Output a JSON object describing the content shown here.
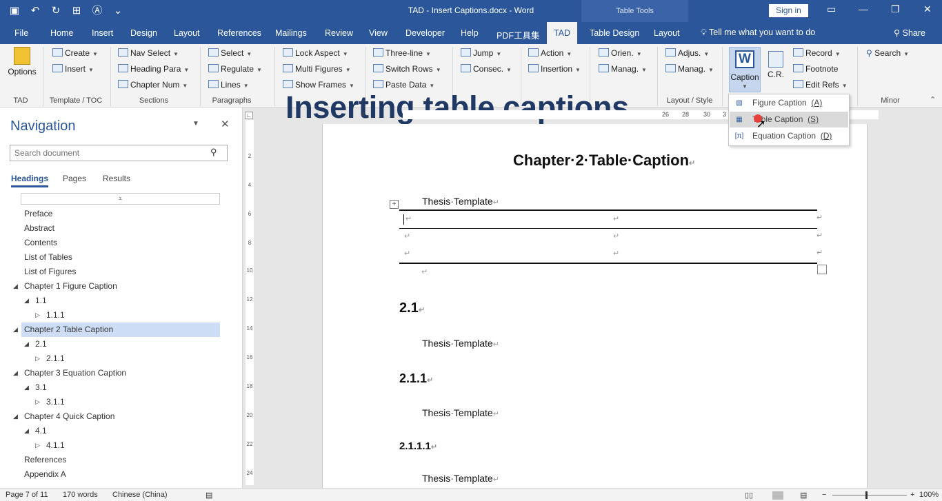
{
  "title_bar": {
    "document_title": "TAD - Insert Captions.docx - Word",
    "context_tab": "Table Tools",
    "sign_in": "Sign in"
  },
  "tabs": [
    "File",
    "Home",
    "Insert",
    "Design",
    "Layout",
    "References",
    "Mailings",
    "Review",
    "View",
    "Developer",
    "Help",
    "PDF工具集",
    "TAD",
    "Table Design",
    "Layout"
  ],
  "active_tab": "TAD",
  "tell_me": "Tell me what you want to do",
  "share": "Share",
  "ribbon": {
    "options": "Options",
    "template_toc": {
      "create": "Create",
      "insert": "Insert",
      "label": "Template / TOC"
    },
    "sections": {
      "nav_select": "Nav Select",
      "heading_para": "Heading Para",
      "chapter_num": "Chapter Num",
      "label": "Sections"
    },
    "paragraphs": {
      "select": "Select",
      "regulate": "Regulate",
      "lines": "Lines",
      "label": "Paragraphs"
    },
    "figures": {
      "lock_aspect": "Lock Aspect",
      "multi_figures": "Multi Figures",
      "show_frames": "Show Frames"
    },
    "tables": {
      "three_line": "Three-line",
      "switch_rows": "Switch Rows",
      "paste_data": "Paste Data"
    },
    "cross_ref": {
      "jump": "Jump",
      "consec": "Consec."
    },
    "fields": {
      "action": "Action",
      "insertion": "Insertion"
    },
    "page_bookmark": {
      "orien": "Orien.",
      "manag": "Manag."
    },
    "layout_style": {
      "adjus": "Adjus.",
      "manag": "Manag.",
      "label": "Layout / Style"
    },
    "caption": {
      "caption": "Caption",
      "cr": "C.R.",
      "record": "Record",
      "footnote": "Footnote",
      "edit_refs": "Edit Refs"
    },
    "minor": {
      "search": "Search",
      "label": "Minor"
    },
    "tad_label": "TAD"
  },
  "overlay_title": "Inserting table captions",
  "navigation": {
    "title": "Navigation",
    "search_placeholder": "Search document",
    "tabs": [
      "Headings",
      "Pages",
      "Results"
    ],
    "items": [
      {
        "label": "Preface"
      },
      {
        "label": "Abstract"
      },
      {
        "label": "Contents"
      },
      {
        "label": "List of Tables"
      },
      {
        "label": "List of Figures"
      },
      {
        "label": "Chapter 1 Figure Caption"
      },
      {
        "label": "1.1"
      },
      {
        "label": "1.1.1"
      },
      {
        "label": "Chapter 2 Table Caption"
      },
      {
        "label": "2.1"
      },
      {
        "label": "2.1.1"
      },
      {
        "label": "Chapter 3 Equation Caption"
      },
      {
        "label": "3.1"
      },
      {
        "label": "3.1.1"
      },
      {
        "label": "Chapter 4 Quick Caption"
      },
      {
        "label": "4.1"
      },
      {
        "label": "4.1.1"
      },
      {
        "label": "References"
      },
      {
        "label": "Appendix A"
      }
    ]
  },
  "ruler_h": [
    "4",
    "26",
    "28",
    "30",
    "3"
  ],
  "ruler_v": [
    "2",
    "4",
    "6",
    "8",
    "10",
    "12",
    "14",
    "16",
    "18",
    "20",
    "22",
    "24"
  ],
  "document": {
    "chapter_heading": "Chapter·2·Table·Caption",
    "table_title": "Thesis·Template",
    "h2": "2.1",
    "body1": "Thesis·Template",
    "h3": "2.1.1",
    "body2": "Thesis·Template",
    "h4": "2.1.1.1",
    "body3": "Thesis·Template",
    "mark": "↵"
  },
  "caption_menu": {
    "items": [
      {
        "label": "Figure Caption",
        "key": "(A)"
      },
      {
        "label": "Table Caption",
        "key": "(S)"
      },
      {
        "label": "Equation Caption",
        "key": "(D)"
      }
    ]
  },
  "status_bar": {
    "page": "Page 7 of 11",
    "words": "170 words",
    "language": "Chinese (China)",
    "zoom": "100%"
  }
}
